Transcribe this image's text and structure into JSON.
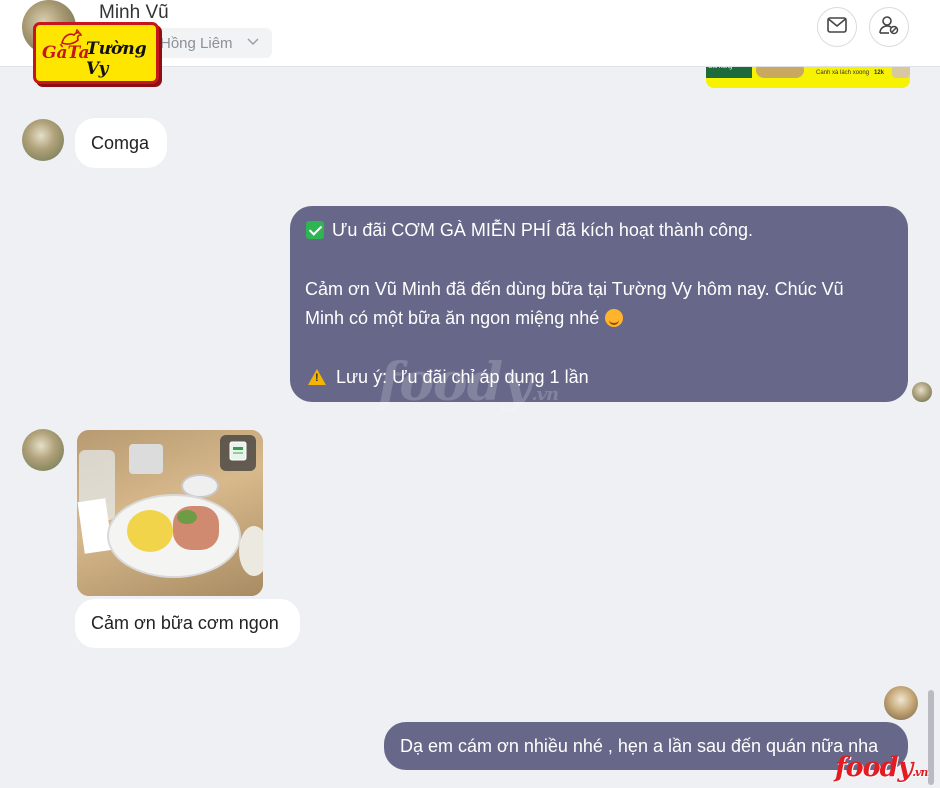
{
  "header": {
    "contact_name": "Minh Vũ",
    "branch_select_value": "Hồng Liêm",
    "logo_left_text": "GàTa",
    "logo_brand_text": "Tường Vy"
  },
  "preview_strip": {
    "caption_left": "Giỏ hàng",
    "caption_right": "Canh xà lách xoong",
    "price": "12k"
  },
  "messages": {
    "incoming_1": "Comga",
    "outgoing_1": {
      "line1": "Ưu đãi CƠM GÀ MIỄN PHÍ đã kích hoạt thành công.",
      "line2": "Cảm ơn Vũ Minh đã đến dùng bữa tại Tường Vy hôm nay. Chúc Vũ",
      "line3": "Minh có một bữa ăn ngon miệng nhé",
      "line4": "Lưu ý: Ưu đãi chỉ áp dụng 1 lần"
    },
    "incoming_2": "Cảm ơn bữa cơm ngon",
    "outgoing_2": "Dạ em cám ơn nhiều nhé , hẹn a lần sau đến quán nữa nha"
  },
  "watermark": {
    "text": "foody",
    "suffix": ".vn"
  },
  "icons": {
    "mail": "mail-icon",
    "user_settings": "user-settings-icon",
    "check": "check-icon",
    "warning": "warning-icon",
    "smile": "smile-icon",
    "image_badge": "image-icon"
  },
  "colors": {
    "outgoing_bubble": "#676889",
    "incoming_bubble": "#ffffff",
    "background": "#eef0f3",
    "brand_red": "#e31b23",
    "logo_yellow": "#ffe600"
  }
}
